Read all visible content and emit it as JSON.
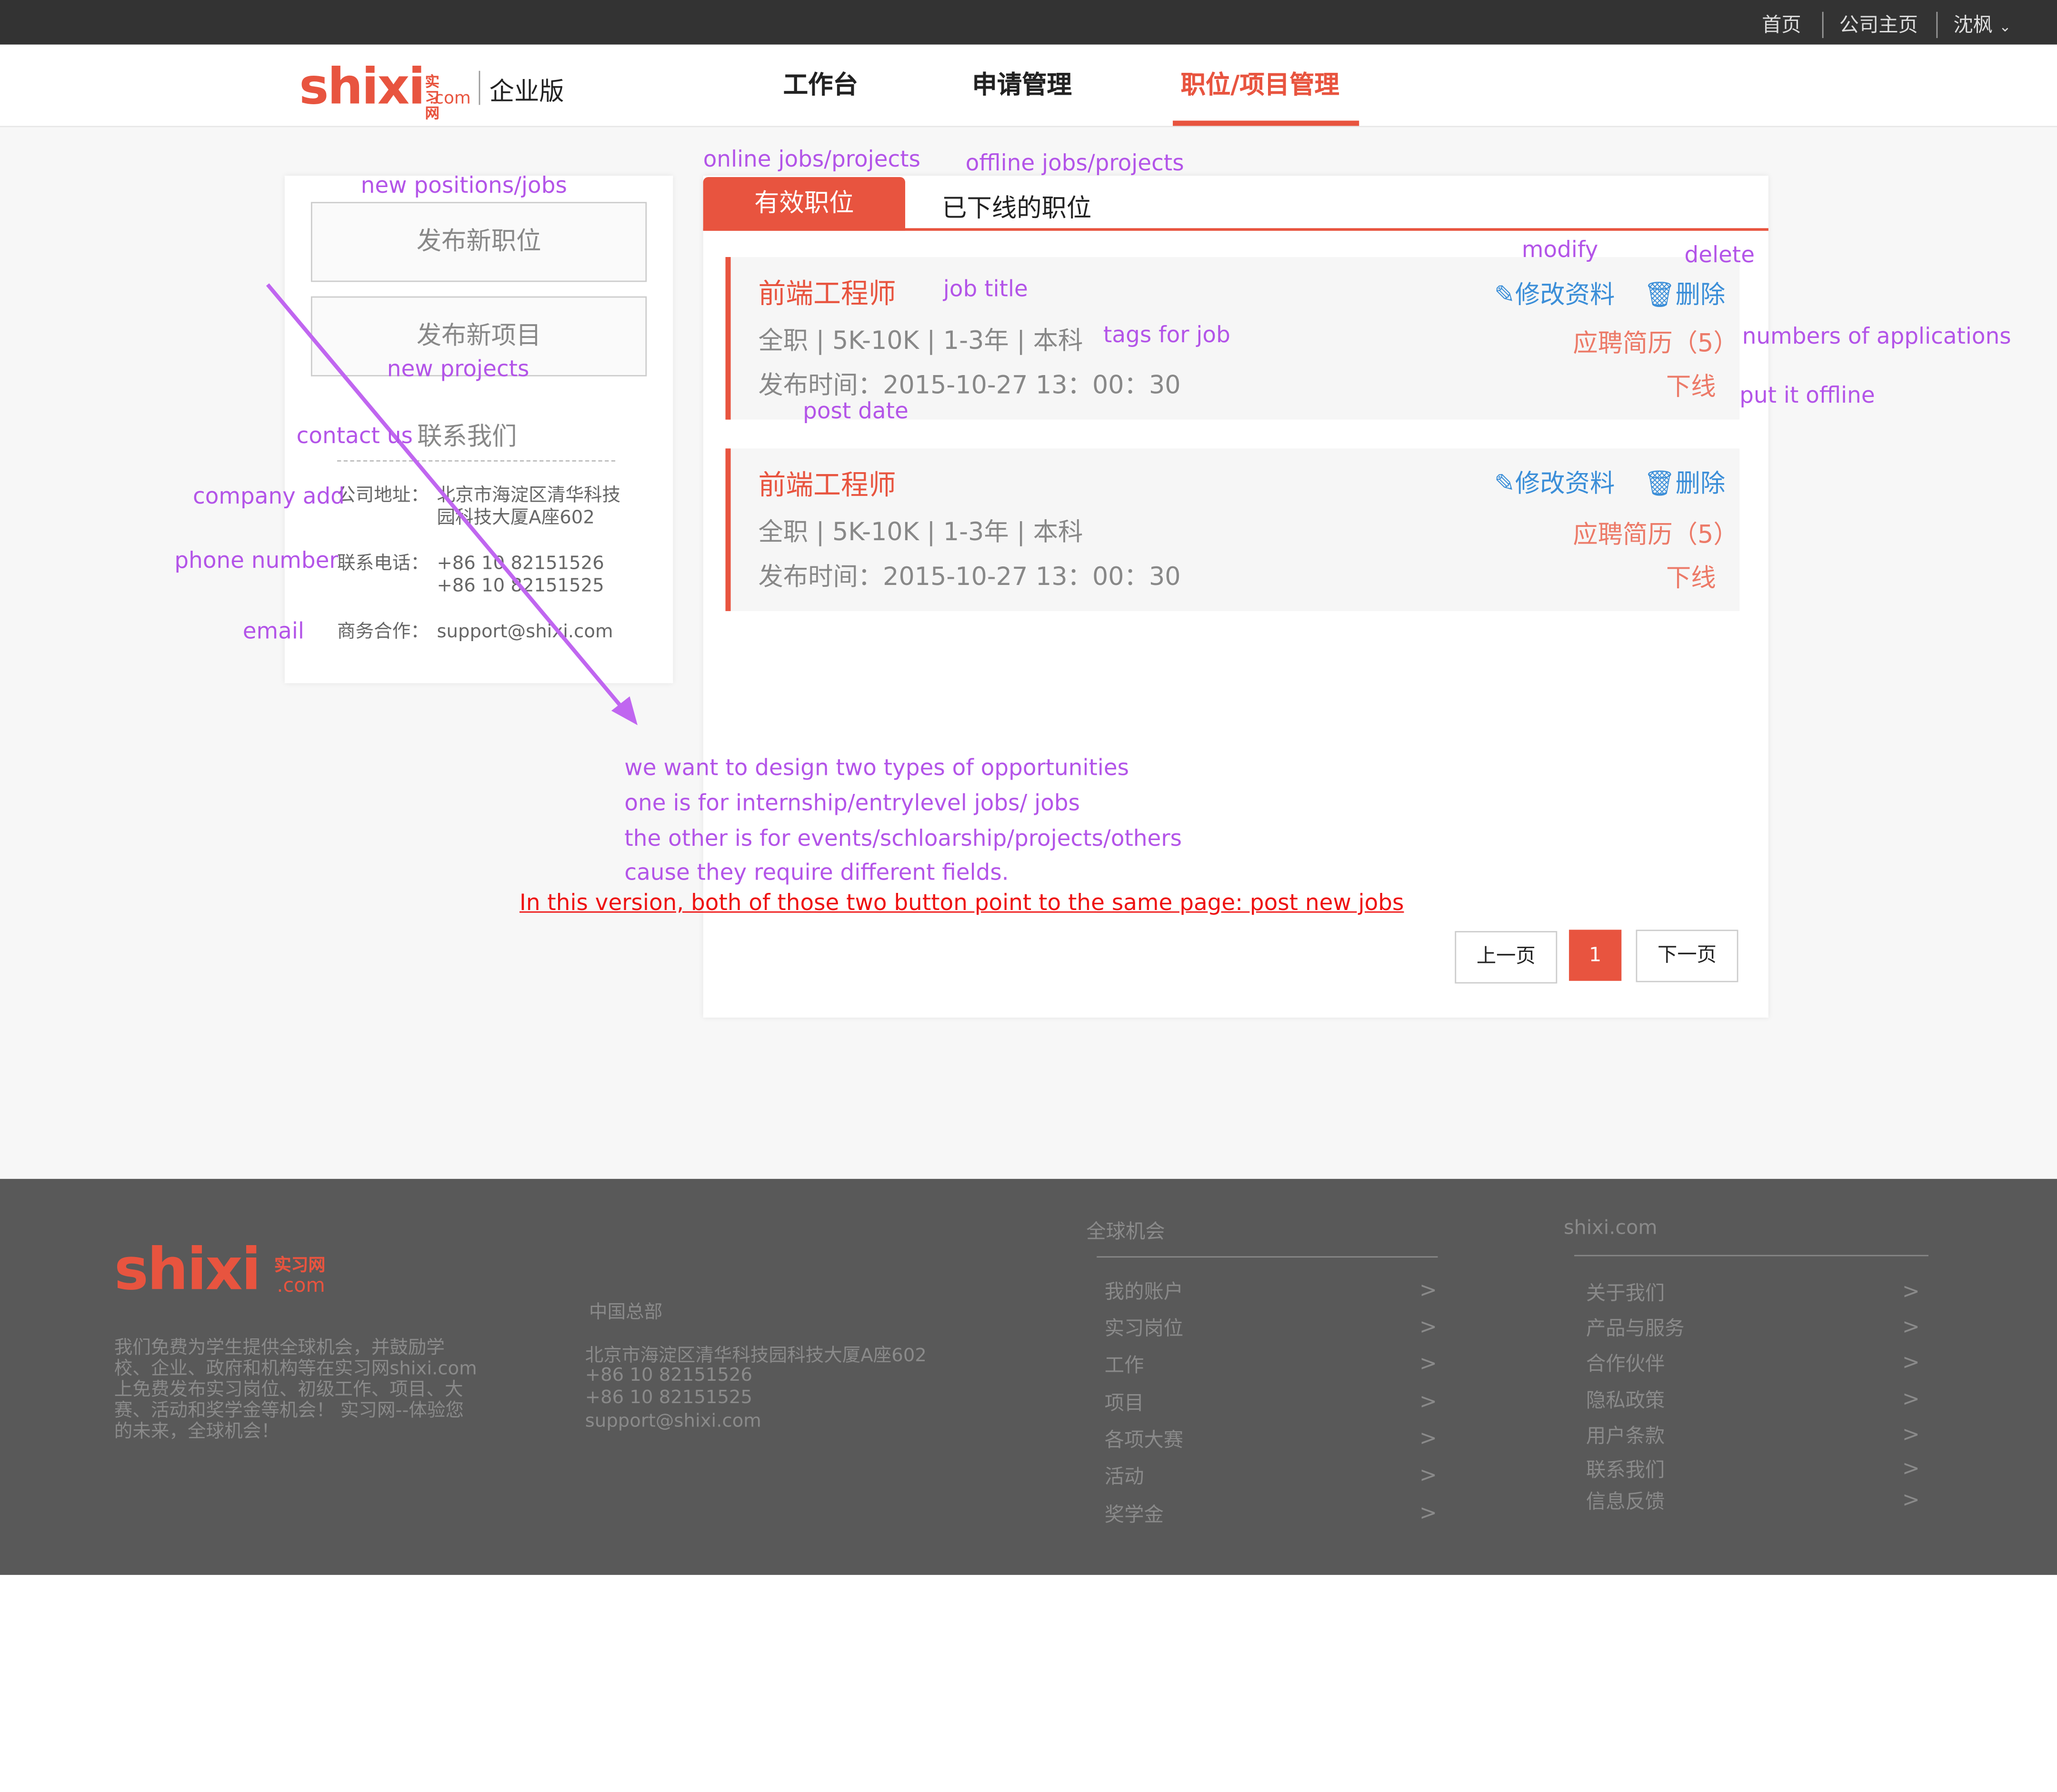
{
  "topbar": {
    "home": "首页",
    "company_home": "公司主页",
    "user": "沈枫"
  },
  "logo": {
    "main": "shixi",
    "cn": "实习网",
    "com": ".com",
    "edition": "企业版"
  },
  "nav": {
    "items": [
      "工作台",
      "申请管理",
      "职位/项目管理"
    ]
  },
  "sidebar": {
    "post_job": "发布新职位",
    "post_project": "发布新项目",
    "contact_title": "联系我们",
    "address_label": "公司地址：",
    "address": "北京市海淀区清华科技园科技大厦A座602",
    "address_line1": "北京市海淀区清华科技",
    "address_line2": "园科技大厦A座602",
    "phone_label": "联系电话：",
    "phone1": "+86 10 82151526",
    "phone2": "+86 10 82151525",
    "biz_label": "商务合作：",
    "email": "support@shixi.com"
  },
  "tabs": {
    "online": "有效职位",
    "offline": "已下线的职位"
  },
  "jobs": [
    {
      "title": "前端工程师",
      "tags": "全职 | 5K-10K | 1-3年 | 本科",
      "date": "发布时间：2015-10-27  13：00：30",
      "edit": "修改资料",
      "delete": "删除",
      "applications": "应聘简历（5）",
      "offline": "下线"
    },
    {
      "title": "前端工程师",
      "tags": "全职 | 5K-10K | 1-3年 | 本科",
      "date": "发布时间：2015-10-27  13：00：30",
      "edit": "修改资料",
      "delete": "删除",
      "applications": "应聘简历（5）",
      "offline": "下线"
    }
  ],
  "pager": {
    "prev": "上一页",
    "current": "1",
    "next": "下一页"
  },
  "annotations": {
    "online": "online jobs/projects",
    "offline": "offline jobs/projects",
    "new_positions": "new positions/jobs",
    "new_projects": "new projects",
    "contact": "contact us",
    "company_add": "company add",
    "phone": "phone number",
    "email": "email",
    "modify": "modify",
    "delete": "delete",
    "job_title": "job title",
    "tags": "tags for job",
    "applications": "numbers of applications",
    "offline_action": "put it offline",
    "post_date": "post date",
    "note_lines": [
      "we want to design two types of opportunities",
      "one is for internship/entrylevel jobs/ jobs",
      "the other is for events/schloarship/projects/others",
      "cause they require different fields."
    ],
    "note_red": "In this version, both of those two button point to the same page: post new jobs"
  },
  "footer": {
    "intro": "我们免费为学生提供全球机会，并鼓励学校、企业、政府和机构等在实习网shixi.com上免费发布实习岗位、初级工作、项目、大赛、活动和奖学金等机会！ 实习网--体验您的未来，全球机会！",
    "intro_lines": [
      "我们免费为学生提供全球机会，并鼓励学",
      "校、企业、政府和机构等在实习网shixi.com",
      "上免费发布实习岗位、初级工作、项目、大",
      "赛、活动和奖学金等机会！ 实习网--体验您",
      "的未来，全球机会！"
    ],
    "hq_title": "中国总部",
    "hq_address": "北京市海淀区清华科技园科技大厦A座602",
    "hq_phone1": "+86 10 82151526",
    "hq_phone2": "+86 10 82151525",
    "hq_email": "support@shixi.com",
    "col1_title": "全球机会",
    "col1": [
      "我的账户",
      "实习岗位",
      "工作",
      "项目",
      "各项大赛",
      "活动",
      "奖学金"
    ],
    "col2_title": "shixi.com",
    "col2": [
      "关于我们",
      "产品与服务",
      "合作伙伴",
      "隐私政策",
      "用户条款",
      "联系我们",
      "信息反馈"
    ],
    "arrow": ">"
  },
  "colors": {
    "brand": "#e8543f",
    "link_blue": "#3b8ed8",
    "annotation": "#b354e8",
    "note_red": "#ee1010"
  }
}
